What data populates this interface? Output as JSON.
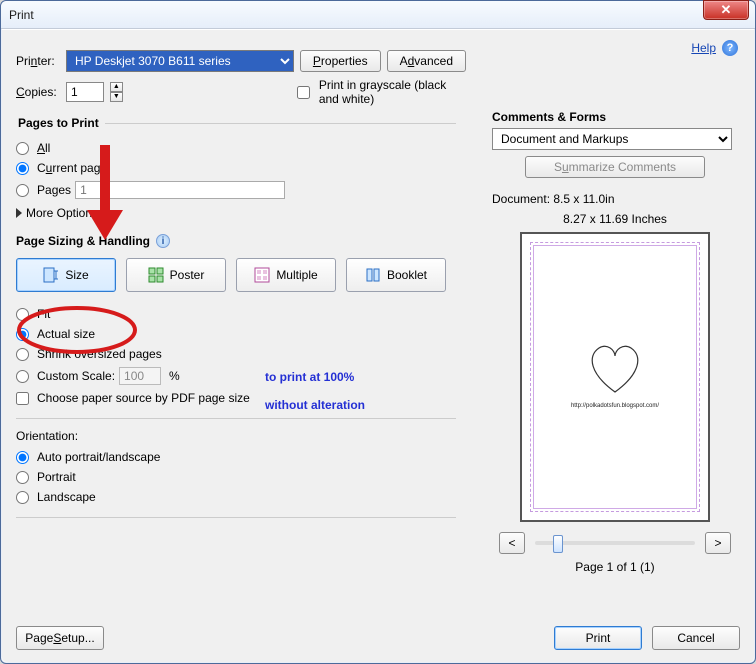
{
  "window": {
    "title": "Print",
    "close_glyph": "✕"
  },
  "help": {
    "label": "Help",
    "glyph": "?"
  },
  "printer": {
    "label_html": "Printer:",
    "selected": "HP Deskjet 3070 B611 series",
    "properties_btn": "Properties",
    "advanced_btn": "Advanced"
  },
  "copies": {
    "label_html": "Copies:",
    "value": "1"
  },
  "grayscale": {
    "label": "Print in grayscale (black and white)"
  },
  "pages_to_print": {
    "legend": "Pages to Print",
    "all": "All",
    "current": "Current page",
    "pages": "Pages",
    "pages_value": "1",
    "more": "More Options",
    "selected": "current"
  },
  "sizing": {
    "legend": "Page Sizing & Handling",
    "info_glyph": "i",
    "tabs": {
      "size": "Size",
      "poster": "Poster",
      "multiple": "Multiple",
      "booklet": "Booklet",
      "active": "size"
    },
    "fit": "Fit",
    "actual": "Actual size",
    "shrink": "Shrink oversized pages",
    "custom": "Custom Scale:",
    "custom_value": "100",
    "pct": "%",
    "paper_source": "Choose paper source by PDF page size",
    "selected": "actual"
  },
  "orientation": {
    "legend": "Orientation:",
    "auto": "Auto portrait/landscape",
    "portrait": "Portrait",
    "landscape": "Landscape",
    "selected": "auto"
  },
  "comments": {
    "legend": "Comments & Forms",
    "selected": "Document and Markups",
    "summarize": "Summarize Comments"
  },
  "preview": {
    "doc_dim": "Document: 8.5 x 11.0in",
    "page_dim": "8.27 x 11.69 Inches",
    "heart_url": "http://polkadotsfun.blogspot.com/",
    "prev": "<",
    "next": ">",
    "page_status": "Page 1 of 1 (1)"
  },
  "bottom": {
    "page_setup": "Page Setup...",
    "print": "Print",
    "cancel": "Cancel"
  },
  "annotation": {
    "line1": "to print at 100%",
    "line2": "without alteration"
  }
}
